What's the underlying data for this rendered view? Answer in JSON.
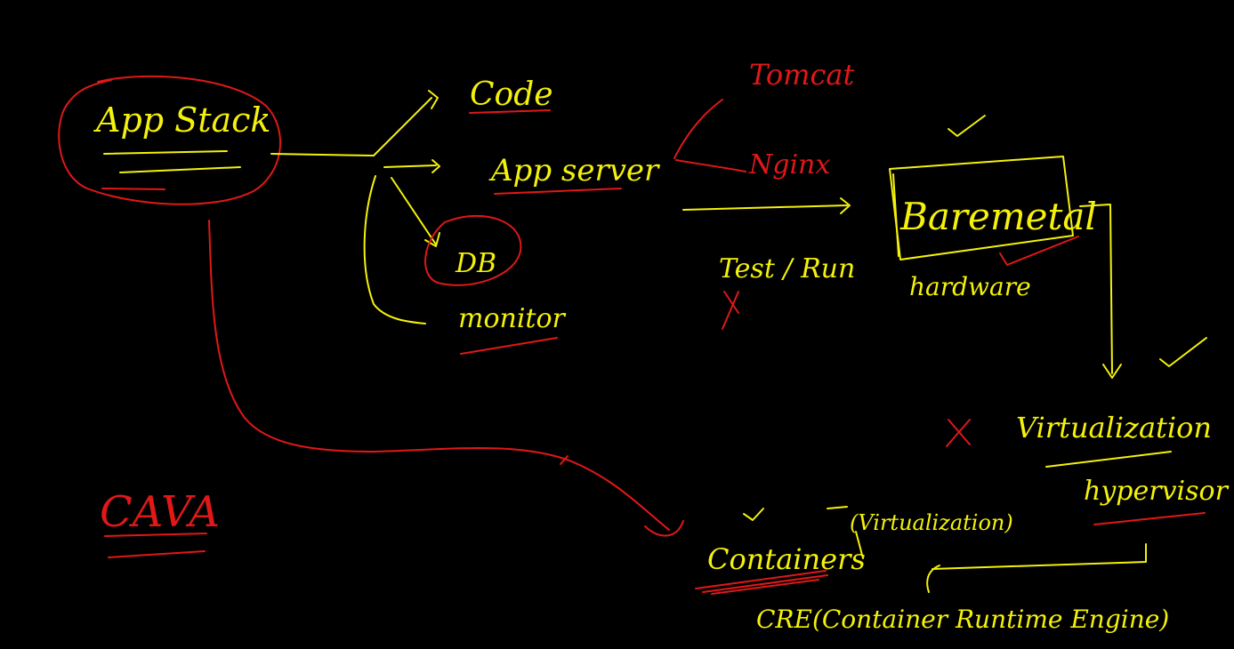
{
  "colors": {
    "background": "#000000",
    "yellow_ink": "#f4f10c",
    "red_ink": "#e01818"
  },
  "labels": {
    "app_stack": "App Stack",
    "code": "Code",
    "app_server": "App server",
    "db": "DB",
    "monitor": "monitor",
    "tomcat": "Tomcat",
    "nginx": "Nginx",
    "test_run": "Test / Run",
    "bare_metal": "Baremetal",
    "hardware": "hardware",
    "virtualization": "Virtualization",
    "hypervisor": "hypervisor",
    "containers": "Containers",
    "containers_note": "(Virtualization)",
    "cre": "CRE(Container Runtime Engine)",
    "cava": "CAVA"
  }
}
